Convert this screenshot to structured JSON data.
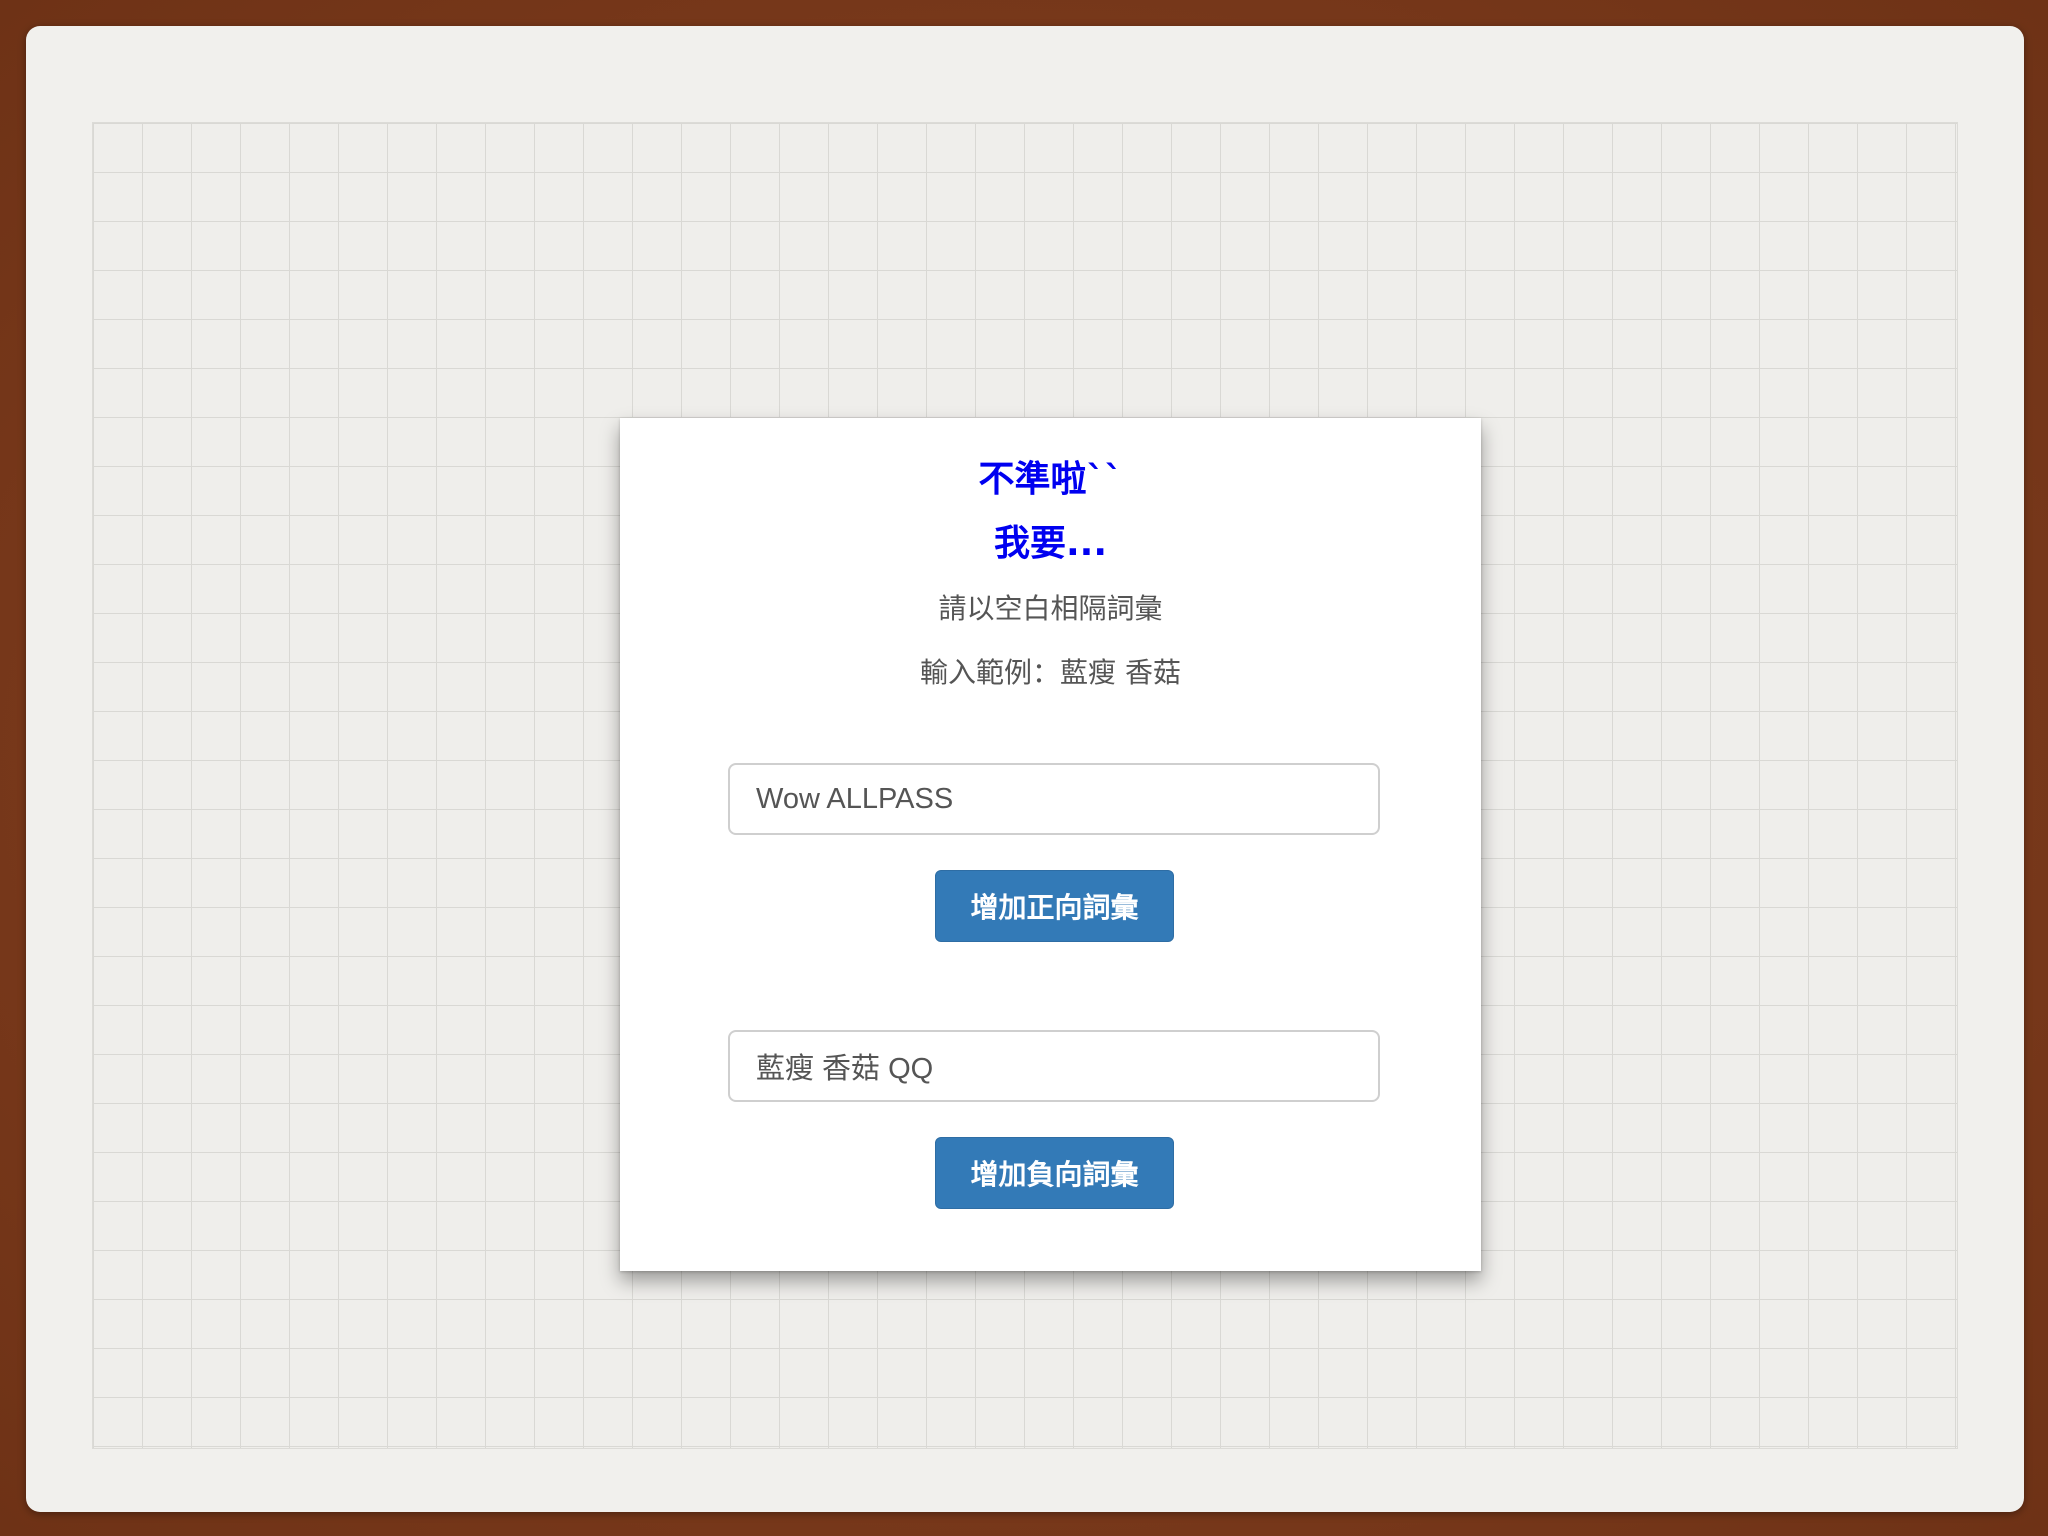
{
  "card": {
    "title_line1": "不準啦``",
    "title_line2": "我要...",
    "hint_line1": "請以空白相隔詞彙",
    "hint_line2": "輸入範例：藍瘦 香菇"
  },
  "positive": {
    "input_value": "Wow ALLPASS",
    "button_label": "增加正向詞彙"
  },
  "negative": {
    "input_value": "藍瘦 香菇 QQ",
    "button_label": "增加負向詞彙"
  },
  "colors": {
    "title": "#0000f0",
    "button": "#337ab7",
    "frame": "#7a3a1c"
  }
}
